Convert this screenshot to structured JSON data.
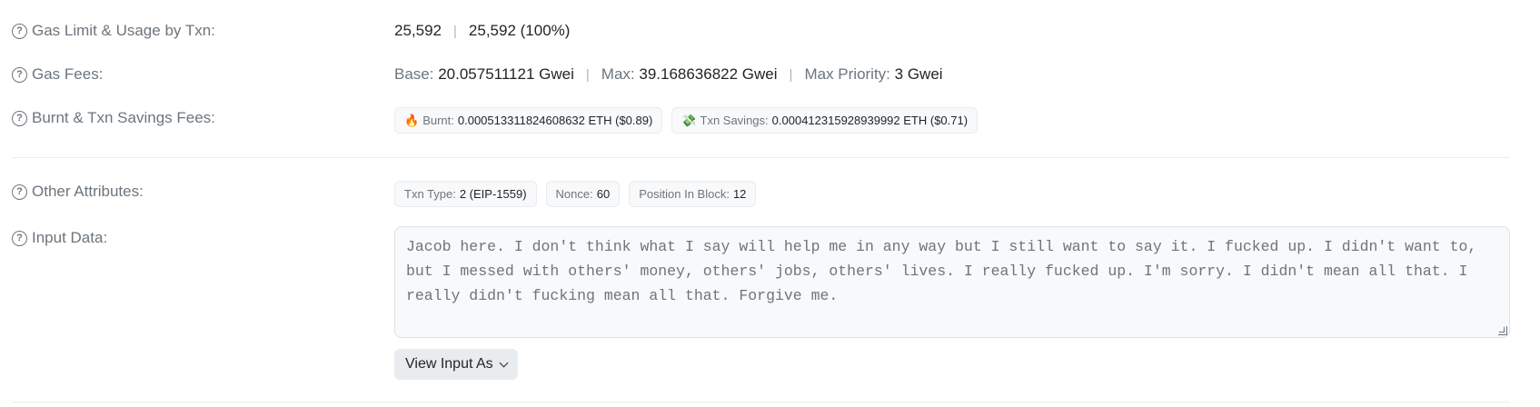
{
  "gas_limit": {
    "label": "Gas Limit & Usage by Txn:",
    "limit": "25,592",
    "sep": "|",
    "usage": "25,592 (100%)"
  },
  "gas_fees": {
    "label": "Gas Fees:",
    "base_key": "Base:",
    "base_val": "20.057511121 Gwei",
    "max_key": "Max:",
    "max_val": "39.168636822 Gwei",
    "prio_key": "Max Priority:",
    "prio_val": "3 Gwei",
    "sep": "|"
  },
  "burnt_savings": {
    "label": "Burnt & Txn Savings Fees:",
    "burnt_icon": "🔥",
    "burnt_key": "Burnt:",
    "burnt_val": "0.000513311824608632 ETH ($0.89)",
    "savings_icon": "💸",
    "savings_key": "Txn Savings:",
    "savings_val": "0.000412315928939992 ETH ($0.71)"
  },
  "other_attributes": {
    "label": "Other Attributes:",
    "txn_type_key": "Txn Type:",
    "txn_type_val": "2 (EIP-1559)",
    "nonce_key": "Nonce:",
    "nonce_val": "60",
    "position_key": "Position In Block:",
    "position_val": "12"
  },
  "input_data": {
    "label": "Input Data:",
    "line1": "Jacob here. I don't think what I say will help me in any way but I still want to say it. I fucked up. I didn't want to,",
    "line2": "but I messed with others' money, others' jobs, others' lives. I really fucked up. I'm sorry. I didn't mean all that. I",
    "line3": "really didn't fucking mean all that. Forgive me.",
    "view_button": "View Input As"
  },
  "help_icon": "question-circle-icon"
}
